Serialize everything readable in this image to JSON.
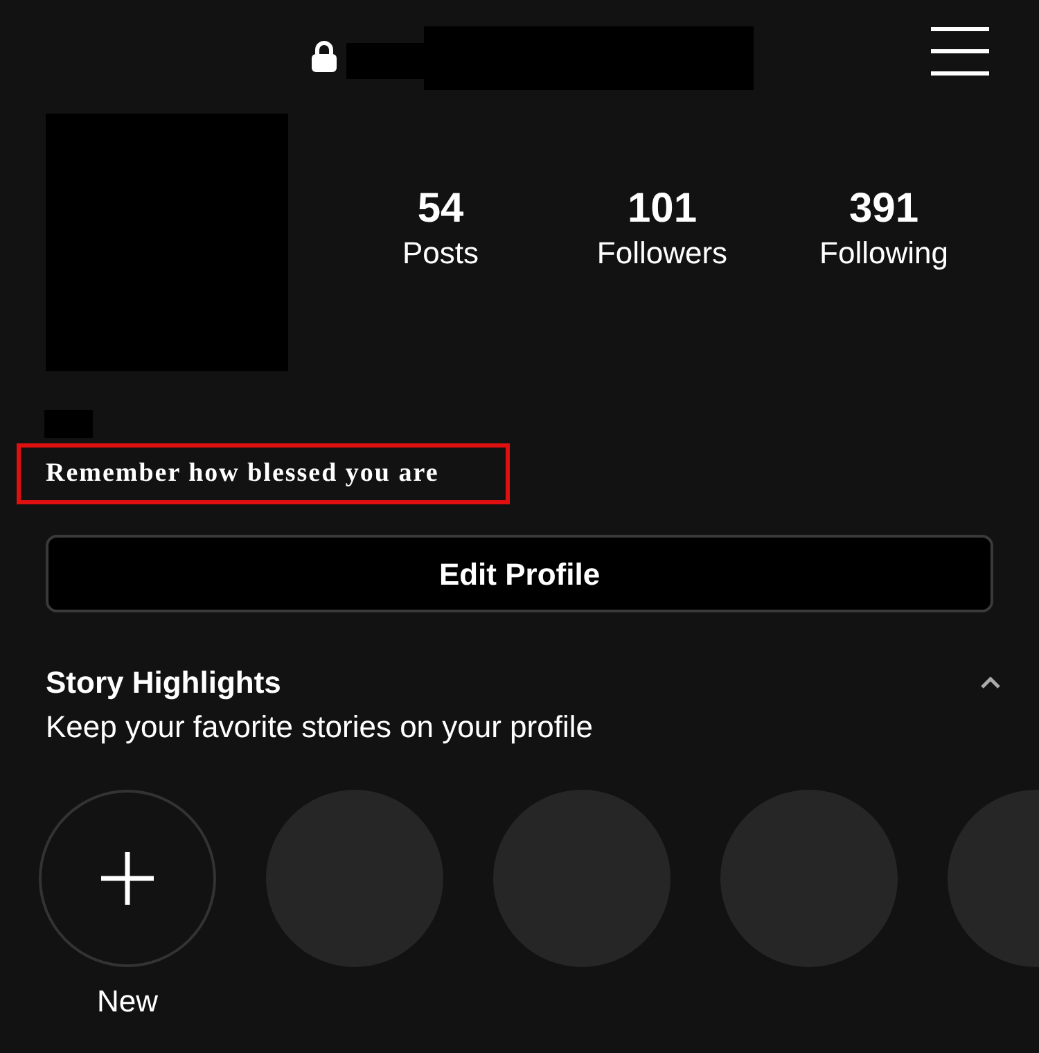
{
  "header": {
    "private": true,
    "username_redacted": true
  },
  "profile": {
    "avatar_redacted": true,
    "name_redacted": true,
    "stats": [
      {
        "value": "54",
        "label": "Posts"
      },
      {
        "value": "101",
        "label": "Followers"
      },
      {
        "value": "391",
        "label": "Following"
      }
    ],
    "bio": {
      "text": "Remember how blessed you are",
      "highlighted": true
    },
    "edit_button": "Edit Profile"
  },
  "highlights": {
    "title": "Story Highlights",
    "subtitle": "Keep your favorite stories on your profile",
    "expanded": true,
    "items": [
      {
        "kind": "new",
        "label": "New"
      },
      {
        "kind": "placeholder"
      },
      {
        "kind": "placeholder"
      },
      {
        "kind": "placeholder"
      },
      {
        "kind": "placeholder"
      }
    ]
  }
}
